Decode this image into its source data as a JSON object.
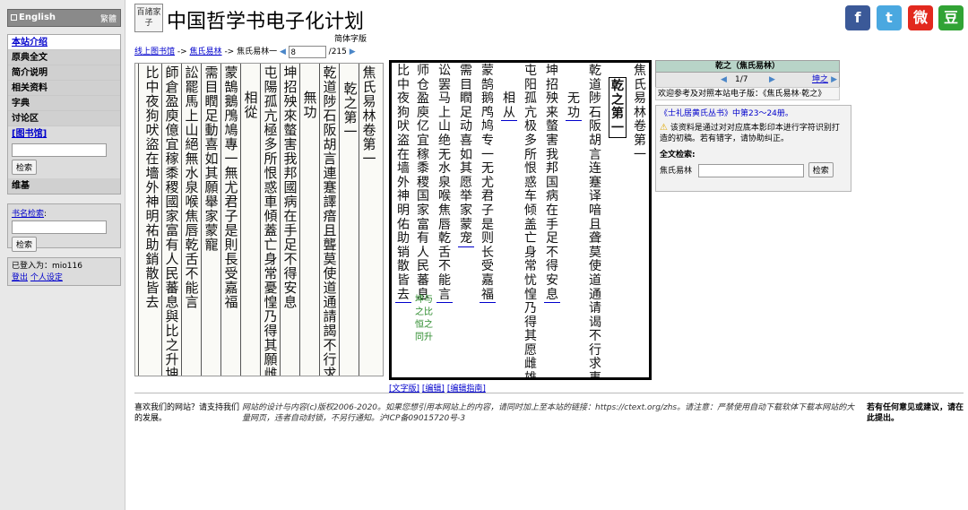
{
  "lang": {
    "english": "English",
    "traditional": "繁體"
  },
  "sidebar": {
    "nav": [
      "本站介绍",
      "原典全文",
      "简介说明",
      "相关资料",
      "字典",
      "讨论区"
    ],
    "library_link": "[图书馆]",
    "search_btn": "检索",
    "wiki": "维基",
    "book_search_label": "书名检索",
    "book_search_btn": "检索",
    "logged_in": "已登入为：mio116",
    "logout": "登出",
    "settings": "个人设定"
  },
  "header": {
    "logo": "百諸家子",
    "title": "中国哲学书电子化计划",
    "script": "简体字版",
    "social": [
      "f",
      "t",
      "微",
      "豆"
    ],
    "social_colors": [
      "#3b5998",
      "#4aa8e0",
      "#e2291e",
      "#31a335"
    ]
  },
  "breadcrumb": {
    "items": [
      "线上图书馆",
      "焦氏易林",
      "焦氏易林一"
    ],
    "page_value": "8",
    "page_total": "/215"
  },
  "scan": {
    "columns": [
      "焦氏易林卷第一",
      "乾之第一",
      "乾 道陟石阪胡言連蹇譯瘖且聾莫使道通請謁不行求事",
      "無功",
      "坤 招殃來螫害我邦國病在手足不得安息",
      "屯 陽孤亢極多所恨惑車傾蓋亡身常憂惶乃得其願雌雄",
      "相從",
      "蒙 鵠鵝鳲鳩專一無尤君子是則長受嘉福",
      "需 目瞤足動喜如其願舉家蒙寵",
      "訟 罷馬上山絕無水泉喉焦唇乾舌不能言",
      "師 倉盈庾億宜稼黍稷國家富有人民蕃息 與比之升 坤之恒之同",
      "比 中夜狗吠盜在墻外神明祐助銷散皆去"
    ]
  },
  "text": {
    "columns": [
      {
        "t": "焦氏易林卷第一",
        "cls": ""
      },
      {
        "t": "乾之第一",
        "cls": "head"
      },
      {
        "t": "乾",
        "cls": "",
        "body": "道陟石阪胡言连蹇译喑且聋莫使道通请谒不行求事"
      },
      {
        "t": "",
        "cls": "",
        "body": "无功"
      },
      {
        "t": "坤",
        "cls": "",
        "body": "招殃来螫害我邦国病在手足不得安息"
      },
      {
        "t": "屯",
        "cls": "",
        "body": "阳孤亢极多所恨惑车倾盖亡身常忧惶乃得其愿雌雄"
      },
      {
        "t": "",
        "cls": "",
        "body": "相从"
      },
      {
        "t": "蒙",
        "cls": "",
        "body": "鹄鹅鸤鸠专一无尤君子是则长受嘉福"
      },
      {
        "t": "需",
        "cls": "",
        "body": "目瞤足动喜如其愿举家蒙宠"
      },
      {
        "t": "讼",
        "cls": "",
        "body": "罢马上山绝无水泉喉焦唇乾舌不能言"
      },
      {
        "t": "师",
        "cls": "",
        "body": "仓盈庾亿宜稼黍稷国家富有人民蕃息"
      },
      {
        "t": "比",
        "cls": "",
        "body": "中夜狗吠盗在墙外神明佑助销散皆去"
      }
    ],
    "note": "坤与之比恒之同升"
  },
  "edit_links": {
    "text_version": "[文字版]",
    "edit": "[编辑]",
    "guide": "[编辑指南]"
  },
  "right_panel": {
    "title": "乾之（焦氏易林）",
    "pager": "1/7",
    "next": "坤之",
    "ref": "欢迎参考及对照本站电子版：《焦氏易林·乾之》",
    "book_ref": "《士礼居黄氏丛书》中第23～24册。",
    "warning": "该资料是通过对对应底本影印本进行字符识别打造的初稿。若有错字，请协助纠正。",
    "search_label": "全文检索:",
    "search_scope": "焦氏易林",
    "search_btn": "检索"
  },
  "footer": {
    "support": "喜欢我们的网站？请支持我们的发展。",
    "legal": "网站的设计与内容(c)版权2006-2020。如果您想引用本网站上的内容，请同时加上至本站的链接：https://ctext.org/zhs。请注意：严禁使用自动下载软体下载本网站的大量网页，违者自动封锁，不另行通知。沪ICP备09015720号-3",
    "feedback": "若有任何意见或建议，请在此提出。"
  }
}
